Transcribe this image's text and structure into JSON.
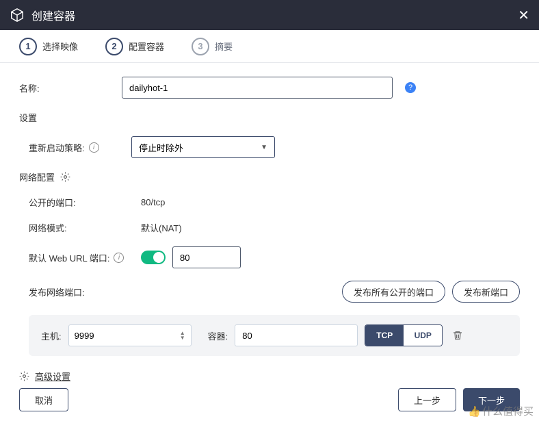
{
  "header": {
    "title": "创建容器"
  },
  "steps": [
    {
      "num": "1",
      "label": "选择映像"
    },
    {
      "num": "2",
      "label": "配置容器"
    },
    {
      "num": "3",
      "label": "摘要"
    }
  ],
  "form": {
    "name_label": "名称:",
    "name_value": "dailyhot-1",
    "settings_title": "设置",
    "restart_label": "重新启动策略:",
    "restart_value": "停止时除外",
    "network_title": "网络配置",
    "exposed_label": "公开的端口:",
    "exposed_value": "80/tcp",
    "mode_label": "网络模式:",
    "mode_value": "默认(NAT)",
    "weburl_label": "默认 Web URL 端口:",
    "weburl_value": "80",
    "publish_label": "发布网络端口:",
    "publish_all_btn": "发布所有公开的端口",
    "publish_new_btn": "发布新端口"
  },
  "port_card": {
    "host_label": "主机:",
    "host_value": "9999",
    "container_label": "容器:",
    "container_value": "80",
    "tcp": "TCP",
    "udp": "UDP"
  },
  "advanced_label": "高级设置",
  "footer": {
    "cancel": "取消",
    "back": "上一步",
    "next": "下一步"
  },
  "watermark": "什么值得买"
}
